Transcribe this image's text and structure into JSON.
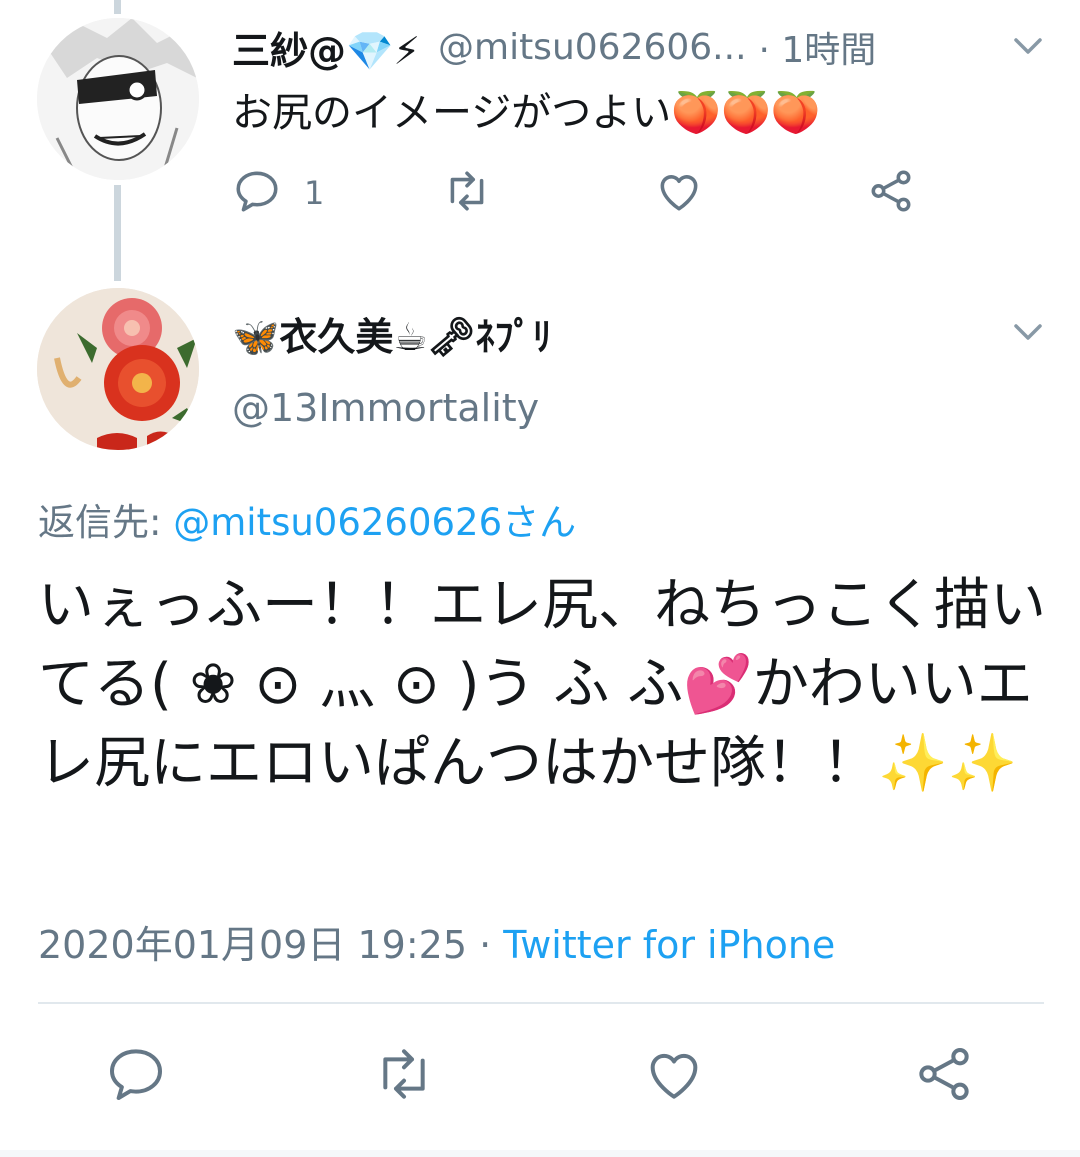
{
  "parent_tweet": {
    "display_name": "三紗@💎⚡",
    "handle": "@mitsu062606...",
    "time": "· 1時間",
    "text": "お尻のイメージがつよい🍑🍑🍑",
    "reply_count": "1"
  },
  "main_tweet": {
    "display_name": "🦋衣久美☕🗝ﾈﾌﾟﾘ",
    "handle": "@13Immortality",
    "reply_to_label": "返信先: ",
    "reply_to_handle": "@mitsu06260626さん",
    "text": "いぇっふー！！エレ尻、ねちっこく描いてる( ❀ ⊙ 灬 ⊙ )う ふ ふ💕かわいいエレ尻にエロいぱんつはかせ隊！！✨✨",
    "date": "2020年01月09日 19:25",
    "separator": " · ",
    "source": "Twitter for iPhone"
  },
  "icons": {
    "reply": "reply-icon",
    "retweet": "retweet-icon",
    "like": "heart-icon",
    "share": "share-icon",
    "more": "chevron-down-icon"
  },
  "colors": {
    "link": "#1da1f2",
    "secondary": "#657786",
    "thread_line": "#ccd6dd",
    "divider": "#e1e8ed"
  }
}
